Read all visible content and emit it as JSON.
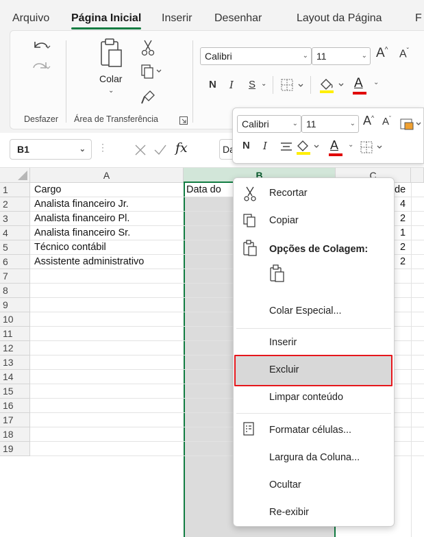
{
  "tabs": [
    "Arquivo",
    "Página Inicial",
    "Inserir",
    "Desenhar",
    "Layout da Página",
    "F"
  ],
  "ribbon": {
    "undo_group_label": "Desfazer",
    "clipboard_group_label": "Área de Transferência",
    "paste_label": "Colar",
    "font_name": "Calibri",
    "font_size": "11",
    "bold": "N",
    "italic": "I",
    "underline": "S",
    "font_color_letter": "A"
  },
  "formula_bar": {
    "name_box": "B1",
    "fx": "fx",
    "formula_preview": "Da"
  },
  "mini_toolbar": {
    "font_name": "Calibri",
    "font_size": "11",
    "bold": "N",
    "italic": "I",
    "font_color_letter": "A"
  },
  "grid": {
    "columns": [
      "A",
      "B",
      "C"
    ],
    "rows": [
      "1",
      "2",
      "3",
      "4",
      "5",
      "6",
      "7",
      "8",
      "9",
      "10",
      "11",
      "12",
      "13",
      "14",
      "15",
      "16",
      "17",
      "18",
      "19"
    ],
    "col_a_cells": [
      "Cargo",
      "Analista financeiro Jr.",
      "Analista financeiro Pl.",
      "Analista financeiro Sr.",
      "Técnico contábil",
      "Assistente administrativo"
    ],
    "col_b_header_cell": "Data do",
    "col_c_cells": [
      "de",
      "4",
      "2",
      "1",
      "2",
      "2"
    ]
  },
  "context_menu": {
    "items": [
      "Recortar",
      "Copiar",
      "Opções de Colagem:",
      "Colar Especial...",
      "Inserir",
      "Excluir",
      "Limpar conteúdo",
      "Formatar células...",
      "Largura da Coluna...",
      "Ocultar",
      "Re-exibir"
    ],
    "highlighted": "Excluir"
  },
  "colors": {
    "accent_green": "#107c41",
    "highlight_red": "#e5161b",
    "font_highlight_yellow": "#ffef00",
    "font_color_red": "#e00000"
  }
}
